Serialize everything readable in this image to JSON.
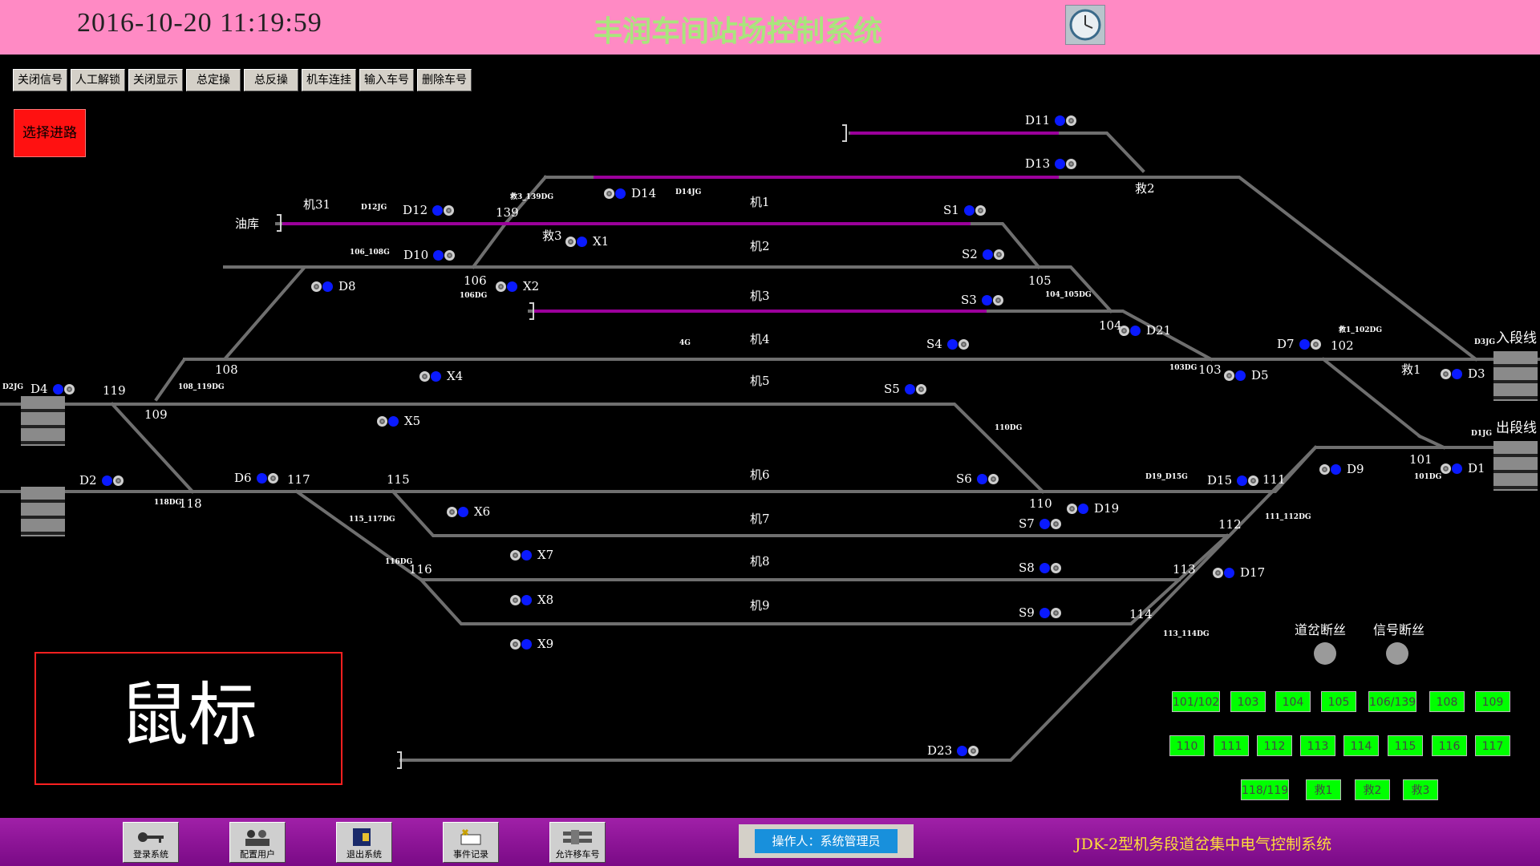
{
  "header": {
    "datetime": "2016-10-20 11:19:59",
    "title": "丰润车间站场控制系统",
    "clock_icon": "clock-icon"
  },
  "toolbar": [
    "关闭信号",
    "人工解锁",
    "关闭显示",
    "总定操",
    "总反操",
    "机车连挂",
    "输入车号",
    "删除车号"
  ],
  "select_route": "选择进路",
  "tracks": [
    "机1",
    "机2",
    "机3",
    "机4",
    "机5",
    "机6",
    "机7",
    "机8",
    "机9"
  ],
  "labels": {
    "oil_depot": "油库",
    "enter_line": "入段线",
    "exit_line": "出段线",
    "ji31": "机31",
    "jiu2": "救2",
    "jiu3": "救3",
    "jiu1": "救1",
    "sw139": "139",
    "sw106": "106",
    "sw108": "108",
    "sw119": "119",
    "sw109": "109",
    "sw118": "118",
    "sw117": "117",
    "sw115": "115",
    "sw116": "116",
    "sw105": "105",
    "sw104": "104",
    "sw103": "103",
    "sw102": "102",
    "sw101": "101",
    "sw110": "110",
    "sw111": "111",
    "sw112": "112",
    "sw113": "113",
    "sw114": "114",
    "sec_D12JG": "D12JG",
    "sec_D14JG": "D14JG",
    "sec_jiu3_139DG": "救3_139DG",
    "sec_106_108G": "106_108G",
    "sec_106DG": "106DG",
    "sec_108_119DG": "108_119DG",
    "sec_D2JG": "D2JG",
    "sec_118DG": "118DG",
    "sec_115_117DG": "115_117DG",
    "sec_116DG": "116DG",
    "sec_4G": "4G",
    "sec_104_105DG": "104_105DG",
    "sec_103DG": "103DG",
    "sec_jiu1_102DG": "救1_102DG",
    "sec_D3JG": "D3JG",
    "sec_110DG": "110DG",
    "sec_D19_D15G": "D19_D15G",
    "sec_111_112DG": "111_112DG",
    "sec_D1JG": "D1JG",
    "sec_101DG": "101DG",
    "sec_113_114DG": "113_114DG"
  },
  "signals": {
    "D11": "D11",
    "D13": "D13",
    "D14": "D14",
    "D12": "D12",
    "D10": "D10",
    "X1": "X1",
    "X2": "X2",
    "D8": "D8",
    "S1": "S1",
    "S2": "S2",
    "S3": "S3",
    "S4": "S4",
    "S5": "S5",
    "S6": "S6",
    "S7": "S7",
    "S8": "S8",
    "S9": "S9",
    "D21": "D21",
    "D7": "D7",
    "D5": "D5",
    "D3": "D3",
    "X4": "X4",
    "X5": "X5",
    "X6": "X6",
    "X7": "X7",
    "X8": "X8",
    "X9": "X9",
    "D4": "D4",
    "D2": "D2",
    "D6": "D6",
    "D19": "D19",
    "D15": "D15",
    "D9": "D9",
    "D1": "D1",
    "D17": "D17",
    "D23": "D23"
  },
  "mouse_label": "鼠标",
  "fuse": {
    "switch_fuse": "道岔断丝",
    "signal_fuse": "信号断丝"
  },
  "switch_buttons": [
    "101/102",
    "103",
    "104",
    "105",
    "106/139",
    "108",
    "109",
    "110",
    "111",
    "112",
    "113",
    "114",
    "115",
    "116",
    "117",
    "118/119",
    "救1",
    "救2",
    "救3"
  ],
  "footer": {
    "buttons": [
      {
        "label": "登录系统",
        "icon": "key-icon"
      },
      {
        "label": "配置用户",
        "icon": "users-icon"
      },
      {
        "label": "退出系统",
        "icon": "exit-icon"
      },
      {
        "label": "事件记录",
        "icon": "event-log-icon"
      },
      {
        "label": "允许移车号",
        "icon": "train-move-icon"
      }
    ],
    "operator": "操作人：系统管理员",
    "system_title": "JDK-2型机务段道岔集中电气控制系统"
  },
  "colors": {
    "header_bg": "#ff8ac4",
    "title": "#a9e57c",
    "track": "#6f6f6f",
    "occupied": "#9b009b",
    "signal_blue": "#0a1aff",
    "switch_green": "#00ff00",
    "footer_bg": "#9a16a4",
    "footer_title": "#ffde3a"
  }
}
